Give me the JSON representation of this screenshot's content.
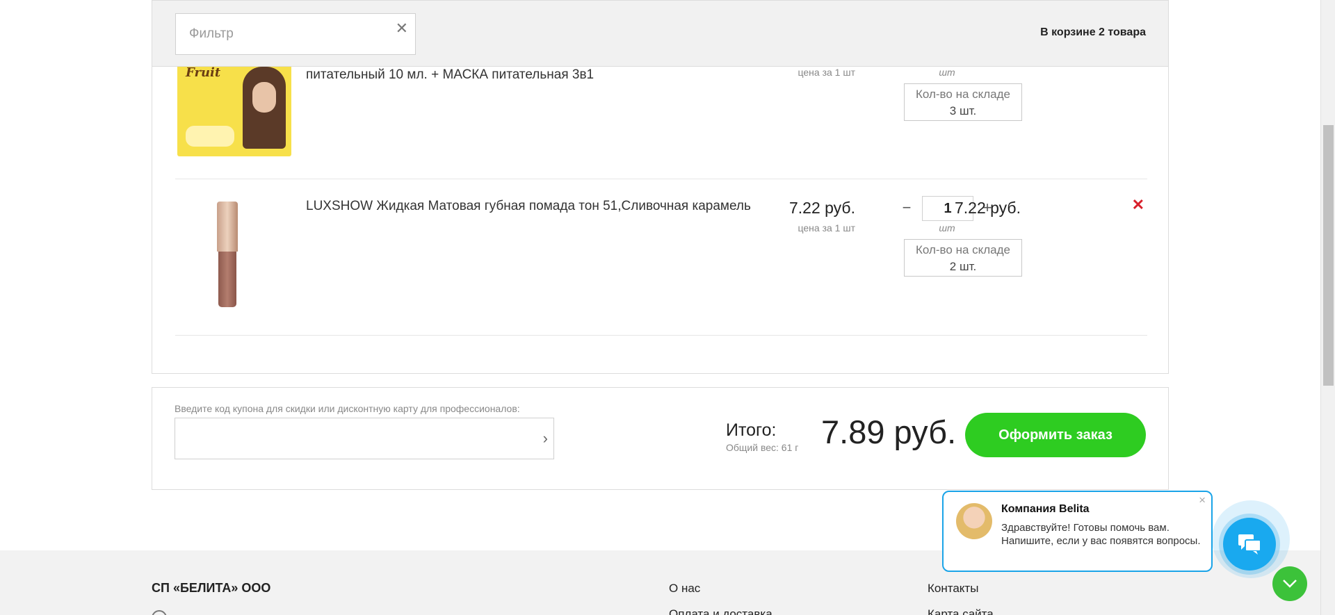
{
  "header": {
    "filter_placeholder": "Фильтр",
    "filter_clear": "✕",
    "cart_count": "В корзине 2 товара"
  },
  "items": [
    {
      "name": "питательный 10 мл. + МАСКА питательная 3в1",
      "price": "",
      "price_note": "цена за 1 шт",
      "quantity": "",
      "unit": "шт",
      "stock_label": "Кол-во на складе",
      "stock_value": "3 шт.",
      "total": "",
      "image_text": "Fruit"
    },
    {
      "name": "LUXSHOW Жидкая Матовая губная помада тон 51,Сливочная карамель",
      "price": "7.22 руб.",
      "price_note": "цена за 1 шт",
      "quantity": "1",
      "minus": "−",
      "plus": "+",
      "unit": "шт",
      "stock_label": "Кол-во на складе",
      "stock_value": "2 шт.",
      "total": "7.22 руб.",
      "remove": "✕"
    }
  ],
  "summary": {
    "coupon_label": "Введите код купона для скидки или дисконтную карту для профессионалов:",
    "coupon_arrow": "›",
    "itogo_label": "Итого:",
    "weight": "Общий вес: 61 г",
    "grand_total": "7.89 руб.",
    "checkout_label": "Оформить заказ"
  },
  "footer": {
    "company": "СП «БЕЛИТА» ООО",
    "links": [
      "О нас",
      "Оплата и доставка",
      "Контакты",
      "Карта сайта"
    ]
  },
  "chat": {
    "title": "Компания Belita",
    "text": "Здравствуйте! Готовы помочь вам. Напишите, если у вас появятся вопросы.",
    "close": "×"
  },
  "colors": {
    "accent_green": "#2ecc21",
    "remove_red": "#d8202b",
    "chat_blue": "#19a9ef"
  },
  "icons": [
    "close-icon",
    "chevron-right-icon",
    "chat-icon",
    "chevron-down-icon",
    "remove-icon"
  ]
}
